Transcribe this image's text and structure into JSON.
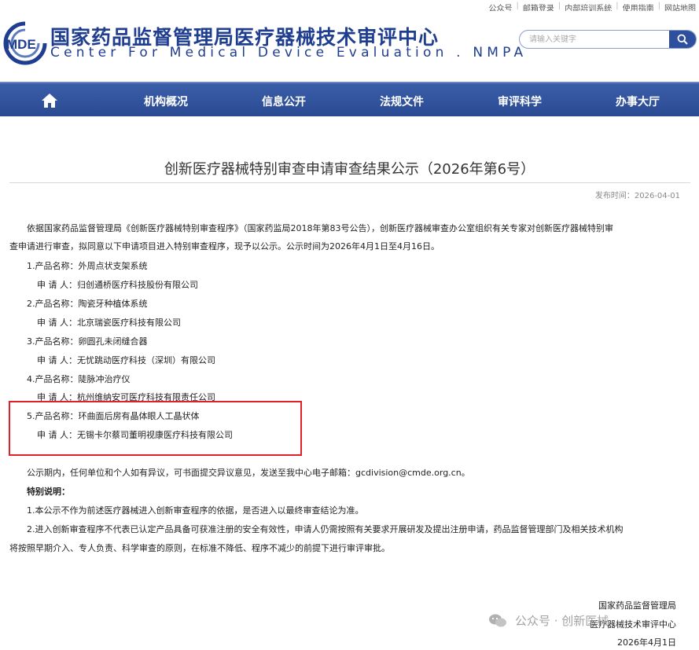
{
  "toplinks": [
    "公众号",
    "邮箱登录",
    "内部培训系统",
    "使用指南",
    "网站地图"
  ],
  "header": {
    "logo_text": "MDE",
    "title": "国家药品监督管理局医疗器械技术审评中心",
    "subtitle": "Center For Medical Device Evaluation . NMPA",
    "search_placeholder": "请输入关键字"
  },
  "nav": {
    "items": [
      "机构概况",
      "信息公开",
      "法规文件",
      "审评科学",
      "办事大厅"
    ]
  },
  "article": {
    "title": "创新医疗器械特别审查申请审查结果公示（2026年第6号）",
    "pubdate": "发布时间：2026-04-01",
    "intro_line1": "依据国家药品监督管理局《创新医疗器械特别审查程序》（国家药监局2018年第83号公告），创新医疗器械审查办公室组织有关专家对创新医疗器械特别审",
    "intro_line2": "查申请进行审查，拟同意以下申请项目进入特别审查程序，现予以公示。公示时间为2026年4月1日至4月16日。",
    "products": [
      {
        "name": "1.产品名称：外周点状支架系统",
        "applicant": "申 请 人：归创通桥医疗科技股份有限公司"
      },
      {
        "name": "2.产品名称：陶瓷牙种植体系统",
        "applicant": "申 请 人：北京瑞瓷医疗科技有限公司"
      },
      {
        "name": "3.产品名称：卵圆孔未闭缝合器",
        "applicant": "申 请 人：无忧跳动医疗科技（深圳）有限公司"
      },
      {
        "name": "4.产品名称：陡脉冲治疗仪",
        "applicant": "申 请 人：杭州维纳安可医疗科技有限责任公司"
      },
      {
        "name": "5.产品名称：环曲面后房有晶体眼人工晶状体",
        "applicant": "申 请 人：无锡卡尔蔡司董明视康医疗科技有限公司"
      }
    ],
    "notice": "公示期内，任何单位和个人如有异议，可书面提交异议意见，发送至我中心电子邮箱：gcdivision@cmde.org.cn。",
    "special_heading": "特别说明：",
    "special_1": "1.本公示不作为前述医疗器械进入创新审查程序的依据，是否进入以最终审查结论为准。",
    "special_2_line1": "2.进入创新审查程序不代表已认定产品具备可获准注册的安全有效性，申请人仍需按照有关要求开展研发及提出注册申请，药品监督管理部门及相关技术机构",
    "special_2_line2": "将按照早期介入、专人负责、科学审查的原则，在标准不降低、程序不减少的前提下进行审评审批。",
    "sign_org1": "国家药品监督管理局",
    "sign_org2": "医疗器械技术审评中心",
    "sign_date": "2026年4月1日"
  },
  "watermark": "公众号 · 创新医械",
  "colors": {
    "brand": "#1f3e8f",
    "nav": "#2d4f9d",
    "highlight": "#e0202b"
  }
}
